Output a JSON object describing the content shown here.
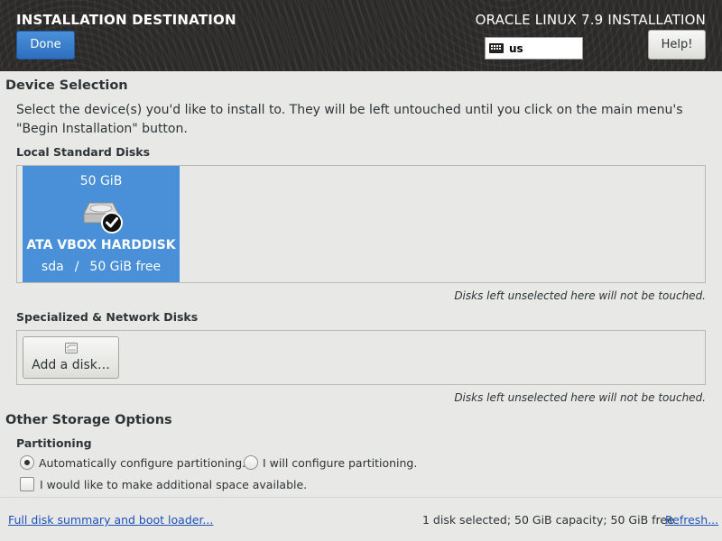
{
  "header": {
    "title": "INSTALLATION DESTINATION",
    "product": "ORACLE LINUX 7.9 INSTALLATION",
    "done_label": "Done",
    "keyboard_layout": "us",
    "help_label": "Help!"
  },
  "device_selection": {
    "title": "Device Selection",
    "instructions": "Select the device(s) you'd like to install to.  They will be left untouched until you click on the main menu's \"Begin Installation\" button.",
    "local_disks_label": "Local Standard Disks",
    "disk": {
      "size": "50 GiB",
      "name": "ATA VBOX HARDDISK",
      "device": "sda",
      "separator": "/",
      "free": "50 GiB free",
      "selected": true
    },
    "local_note": "Disks left unselected here will not be touched.",
    "specialized_label": "Specialized & Network Disks",
    "add_disk_label": "Add a disk…",
    "specialized_note": "Disks left unselected here will not be touched."
  },
  "storage_options": {
    "title": "Other Storage Options",
    "partitioning_label": "Partitioning",
    "auto_label": "Automatically configure partitioning.",
    "manual_label": "I will configure partitioning.",
    "selected": "auto",
    "space_label": "I would like to make additional space available.",
    "space_checked": false
  },
  "footer": {
    "summary_link": "Full disk summary and boot loader...",
    "status": "1 disk selected; 50 GiB capacity; 50 GiB free",
    "refresh_link": "Refresh..."
  },
  "colors": {
    "accent": "#4a90d9",
    "header_bg": "#2b2a28",
    "link": "#1c51b8"
  }
}
